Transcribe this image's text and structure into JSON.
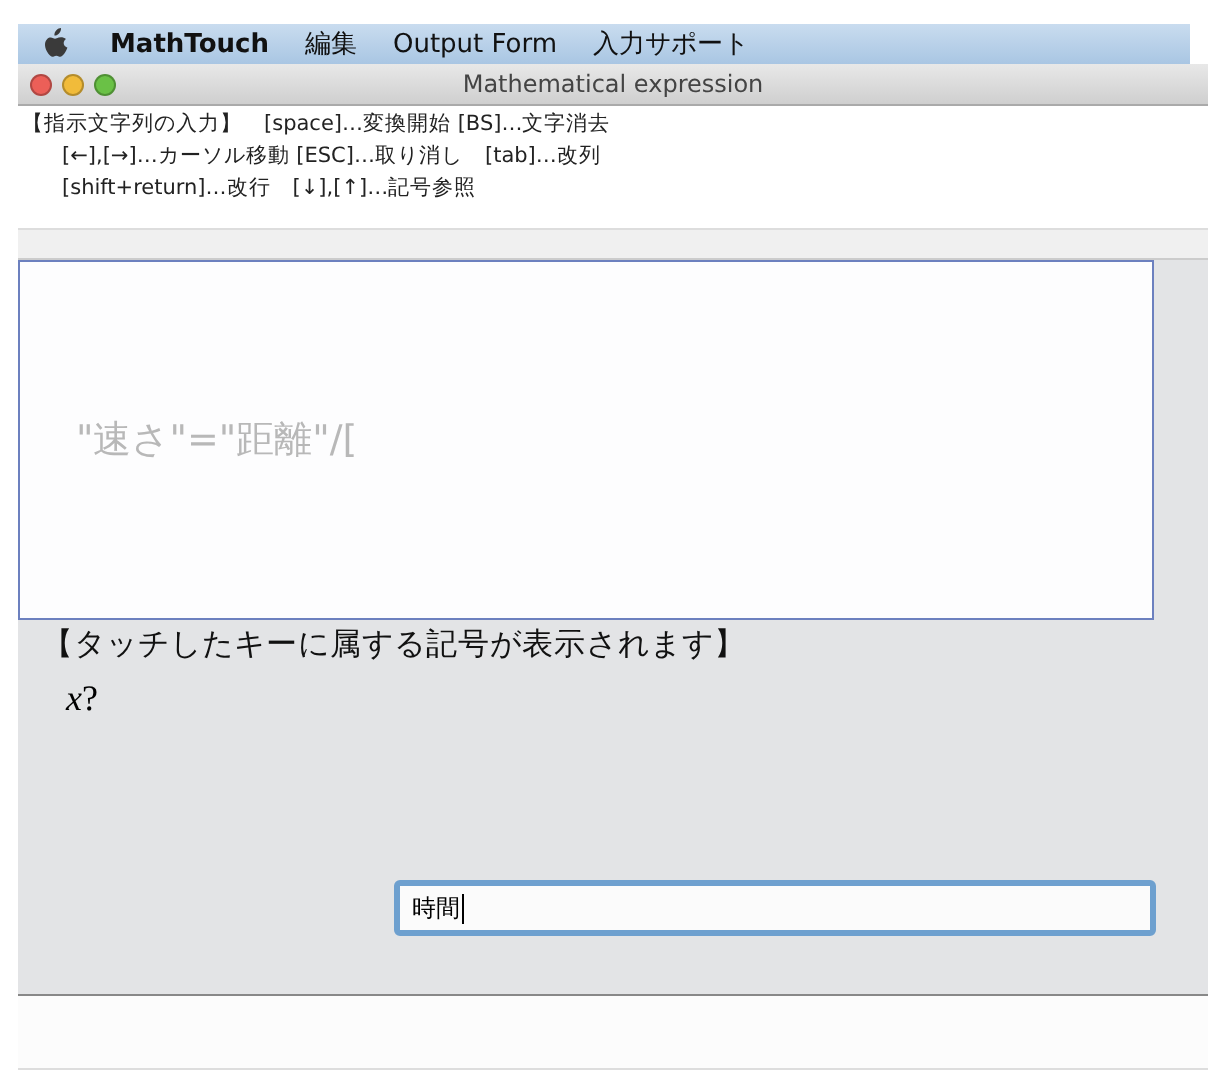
{
  "menu_bar": {
    "items": [
      {
        "kind": "app",
        "label": "MathTouch"
      },
      {
        "kind": "menu",
        "label": "編集"
      },
      {
        "kind": "menu",
        "label": "Output Form"
      },
      {
        "kind": "menu",
        "label": "入力サポート"
      }
    ]
  },
  "window": {
    "title": "Mathematical expression",
    "buttons": [
      {
        "color": "#ec5f58"
      },
      {
        "color": "#f1bb3a"
      },
      {
        "color": "#6ac146"
      }
    ]
  },
  "instructions": [
    "【指示文字列の入力】　[space]…変換開始 [BS]…文字消去",
    "[←],[→]…カーソル移動 [ESC]…取り消し　[tab]…改列",
    "[shift+return]…改行　[↓],[↑]…記号参照"
  ],
  "editor": {
    "text": "\"速さ\"=\"距離\"/["
  },
  "symbol_panel": {
    "heading": "【タッチしたキーに属する記号が表示されます】",
    "symbols": [
      "*x*?"
    ]
  },
  "input_field": {
    "value": "時間"
  }
}
